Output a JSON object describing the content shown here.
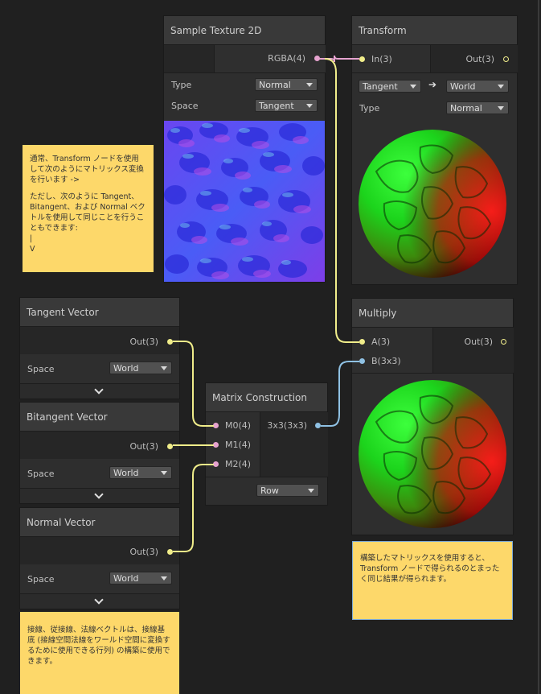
{
  "colors": {
    "canvas": "#202020",
    "node_body": "#2e2e2e",
    "node_header": "#393939",
    "port_vector3": "#f0ed8a",
    "port_matrix4": "#e6a3cf",
    "port_matrix3": "#8fc1e3",
    "sticky": "#fdd86a"
  },
  "sample_texture": {
    "title": "Sample Texture 2D",
    "output": "RGBA(4)",
    "type_label": "Type",
    "type_value": "Normal",
    "space_label": "Space",
    "space_value": "Tangent"
  },
  "transform": {
    "title": "Transform",
    "input": "In(3)",
    "output": "Out(3)",
    "from_space": "Tangent",
    "arrow": "➔",
    "to_space": "World",
    "type_label": "Type",
    "type_value": "Normal"
  },
  "multiply": {
    "title": "Multiply",
    "input_a": "A(3)",
    "input_b": "B(3x3)",
    "output": "Out(3)"
  },
  "tangent_vector": {
    "title": "Tangent Vector",
    "output": "Out(3)",
    "space_label": "Space",
    "space_value": "World"
  },
  "bitangent_vector": {
    "title": "Bitangent Vector",
    "output": "Out(3)",
    "space_label": "Space",
    "space_value": "World"
  },
  "normal_vector": {
    "title": "Normal Vector",
    "output": "Out(3)",
    "space_label": "Space",
    "space_value": "World"
  },
  "matrix_construction": {
    "title": "Matrix Construction",
    "input_m0": "M0(4)",
    "input_m1": "M1(4)",
    "input_m2": "M2(4)",
    "output": "3x3(3x3)",
    "mode_value": "Row"
  },
  "notes": {
    "left_p1": "通常、Transform ノードを使用して次のようにマトリックス変換を行います ->",
    "left_p2": "ただし、次のように Tangent、Bitangent、および Normal ベクトルを使用して同じことを行うこともできます:",
    "left_p3": "|",
    "left_p4": "V",
    "bottom_left": "接線、従接線、法線ベクトルは、接線基底 (接線空間法線をワールド空間に変換するために使用できる行列) の構築に使用できます。",
    "bottom_right": "構築したマトリックスを使用すると、Transform ノードで得られるのとまったく同じ結果が得られます。"
  }
}
